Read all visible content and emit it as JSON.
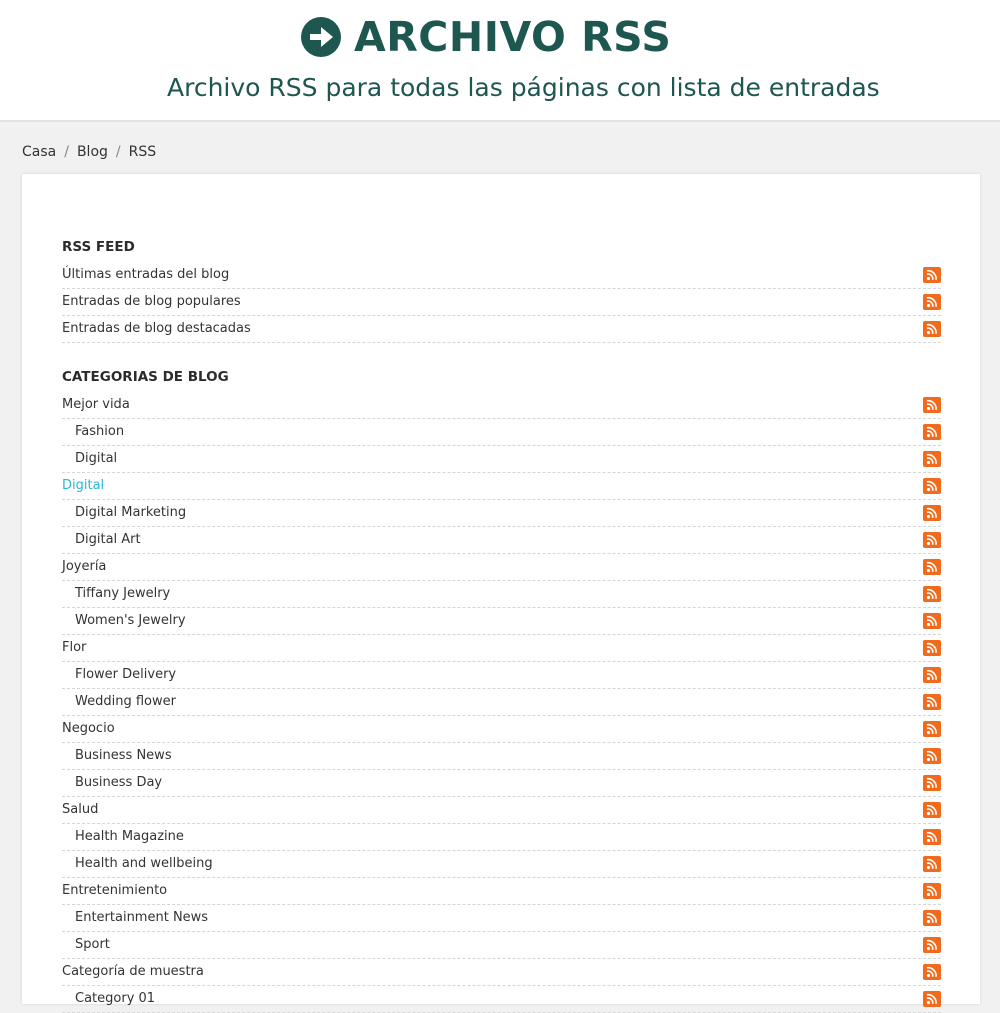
{
  "header": {
    "title": "ARCHIVO RSS",
    "subtitle": "Archivo RSS para todas las páginas con lista de entradas"
  },
  "breadcrumb": {
    "items": [
      "Casa",
      "Blog",
      "RSS"
    ],
    "separator": "/"
  },
  "colors": {
    "brand": "#1e5650",
    "rss_orange": "#f26b1d",
    "active_link": "#2bb6d9"
  },
  "rss_feed": {
    "title": "RSS FEED",
    "items": [
      {
        "label": "Últimas entradas del blog",
        "indent": false
      },
      {
        "label": "Entradas de blog populares",
        "indent": false
      },
      {
        "label": "Entradas de blog destacadas",
        "indent": false
      }
    ]
  },
  "categories": {
    "title": "CATEGORIAS DE BLOG",
    "items": [
      {
        "label": "Mejor vida",
        "indent": false
      },
      {
        "label": "Fashion",
        "indent": true
      },
      {
        "label": "Digital",
        "indent": true
      },
      {
        "label": "Digital",
        "indent": false,
        "active": true
      },
      {
        "label": "Digital Marketing",
        "indent": true
      },
      {
        "label": "Digital Art",
        "indent": true
      },
      {
        "label": "Joyería",
        "indent": false
      },
      {
        "label": "Tiffany Jewelry",
        "indent": true
      },
      {
        "label": "Women's Jewelry",
        "indent": true
      },
      {
        "label": "Flor",
        "indent": false
      },
      {
        "label": "Flower Delivery",
        "indent": true
      },
      {
        "label": "Wedding flower",
        "indent": true
      },
      {
        "label": "Negocio",
        "indent": false
      },
      {
        "label": "Business News",
        "indent": true
      },
      {
        "label": "Business Day",
        "indent": true
      },
      {
        "label": "Salud",
        "indent": false
      },
      {
        "label": "Health Magazine",
        "indent": true
      },
      {
        "label": "Health and wellbeing",
        "indent": true
      },
      {
        "label": "Entretenimiento",
        "indent": false
      },
      {
        "label": "Entertainment News",
        "indent": true
      },
      {
        "label": "Sport",
        "indent": true
      },
      {
        "label": "Categoría de muestra",
        "indent": false
      },
      {
        "label": "Category 01",
        "indent": true
      }
    ]
  },
  "icons": {
    "title": "arrow-circle-right-icon",
    "feed": "rss-icon"
  }
}
